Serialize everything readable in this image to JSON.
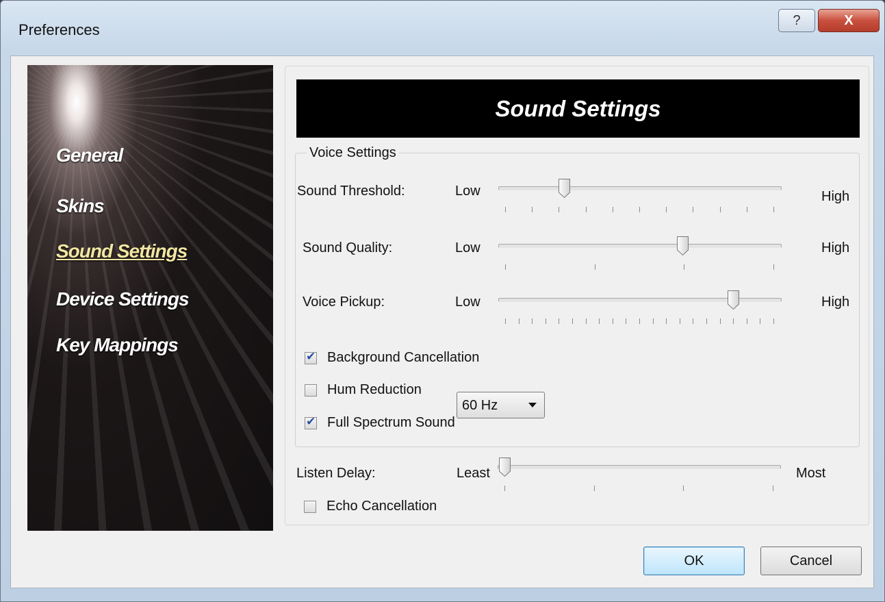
{
  "window": {
    "title": "Preferences",
    "help_label": "?",
    "close_label": "X"
  },
  "nav": {
    "items": [
      {
        "label": "General",
        "active": false
      },
      {
        "label": "Skins",
        "active": false
      },
      {
        "label": "Sound Settings",
        "active": true
      },
      {
        "label": "Device Settings",
        "active": false
      },
      {
        "label": "Key Mappings",
        "active": false
      }
    ]
  },
  "content": {
    "header": "Sound Settings",
    "voice_group": {
      "legend": "Voice Settings",
      "sliders": [
        {
          "label": "Sound Threshold:",
          "low": "Low",
          "high": "High",
          "value_fraction": 0.22
        },
        {
          "label": "Sound Quality:",
          "low": "Low",
          "high": "High",
          "value_fraction": 0.66
        },
        {
          "label": "Voice Pickup:",
          "low": "Low",
          "high": "High",
          "value_fraction": 0.85
        }
      ],
      "checkboxes": [
        {
          "label": "Background Cancellation",
          "checked": true
        },
        {
          "label": "Hum Reduction",
          "checked": false
        },
        {
          "label": "Full Spectrum Sound",
          "checked": true
        }
      ],
      "hum_frequency": {
        "selected": "60 Hz"
      }
    },
    "listen_delay": {
      "label": "Listen Delay:",
      "low": "Least",
      "high": "Most",
      "value_fraction": 0.0
    },
    "echo_cancellation": {
      "label": "Echo Cancellation",
      "checked": false
    }
  },
  "buttons": {
    "ok": "OK",
    "cancel": "Cancel"
  }
}
